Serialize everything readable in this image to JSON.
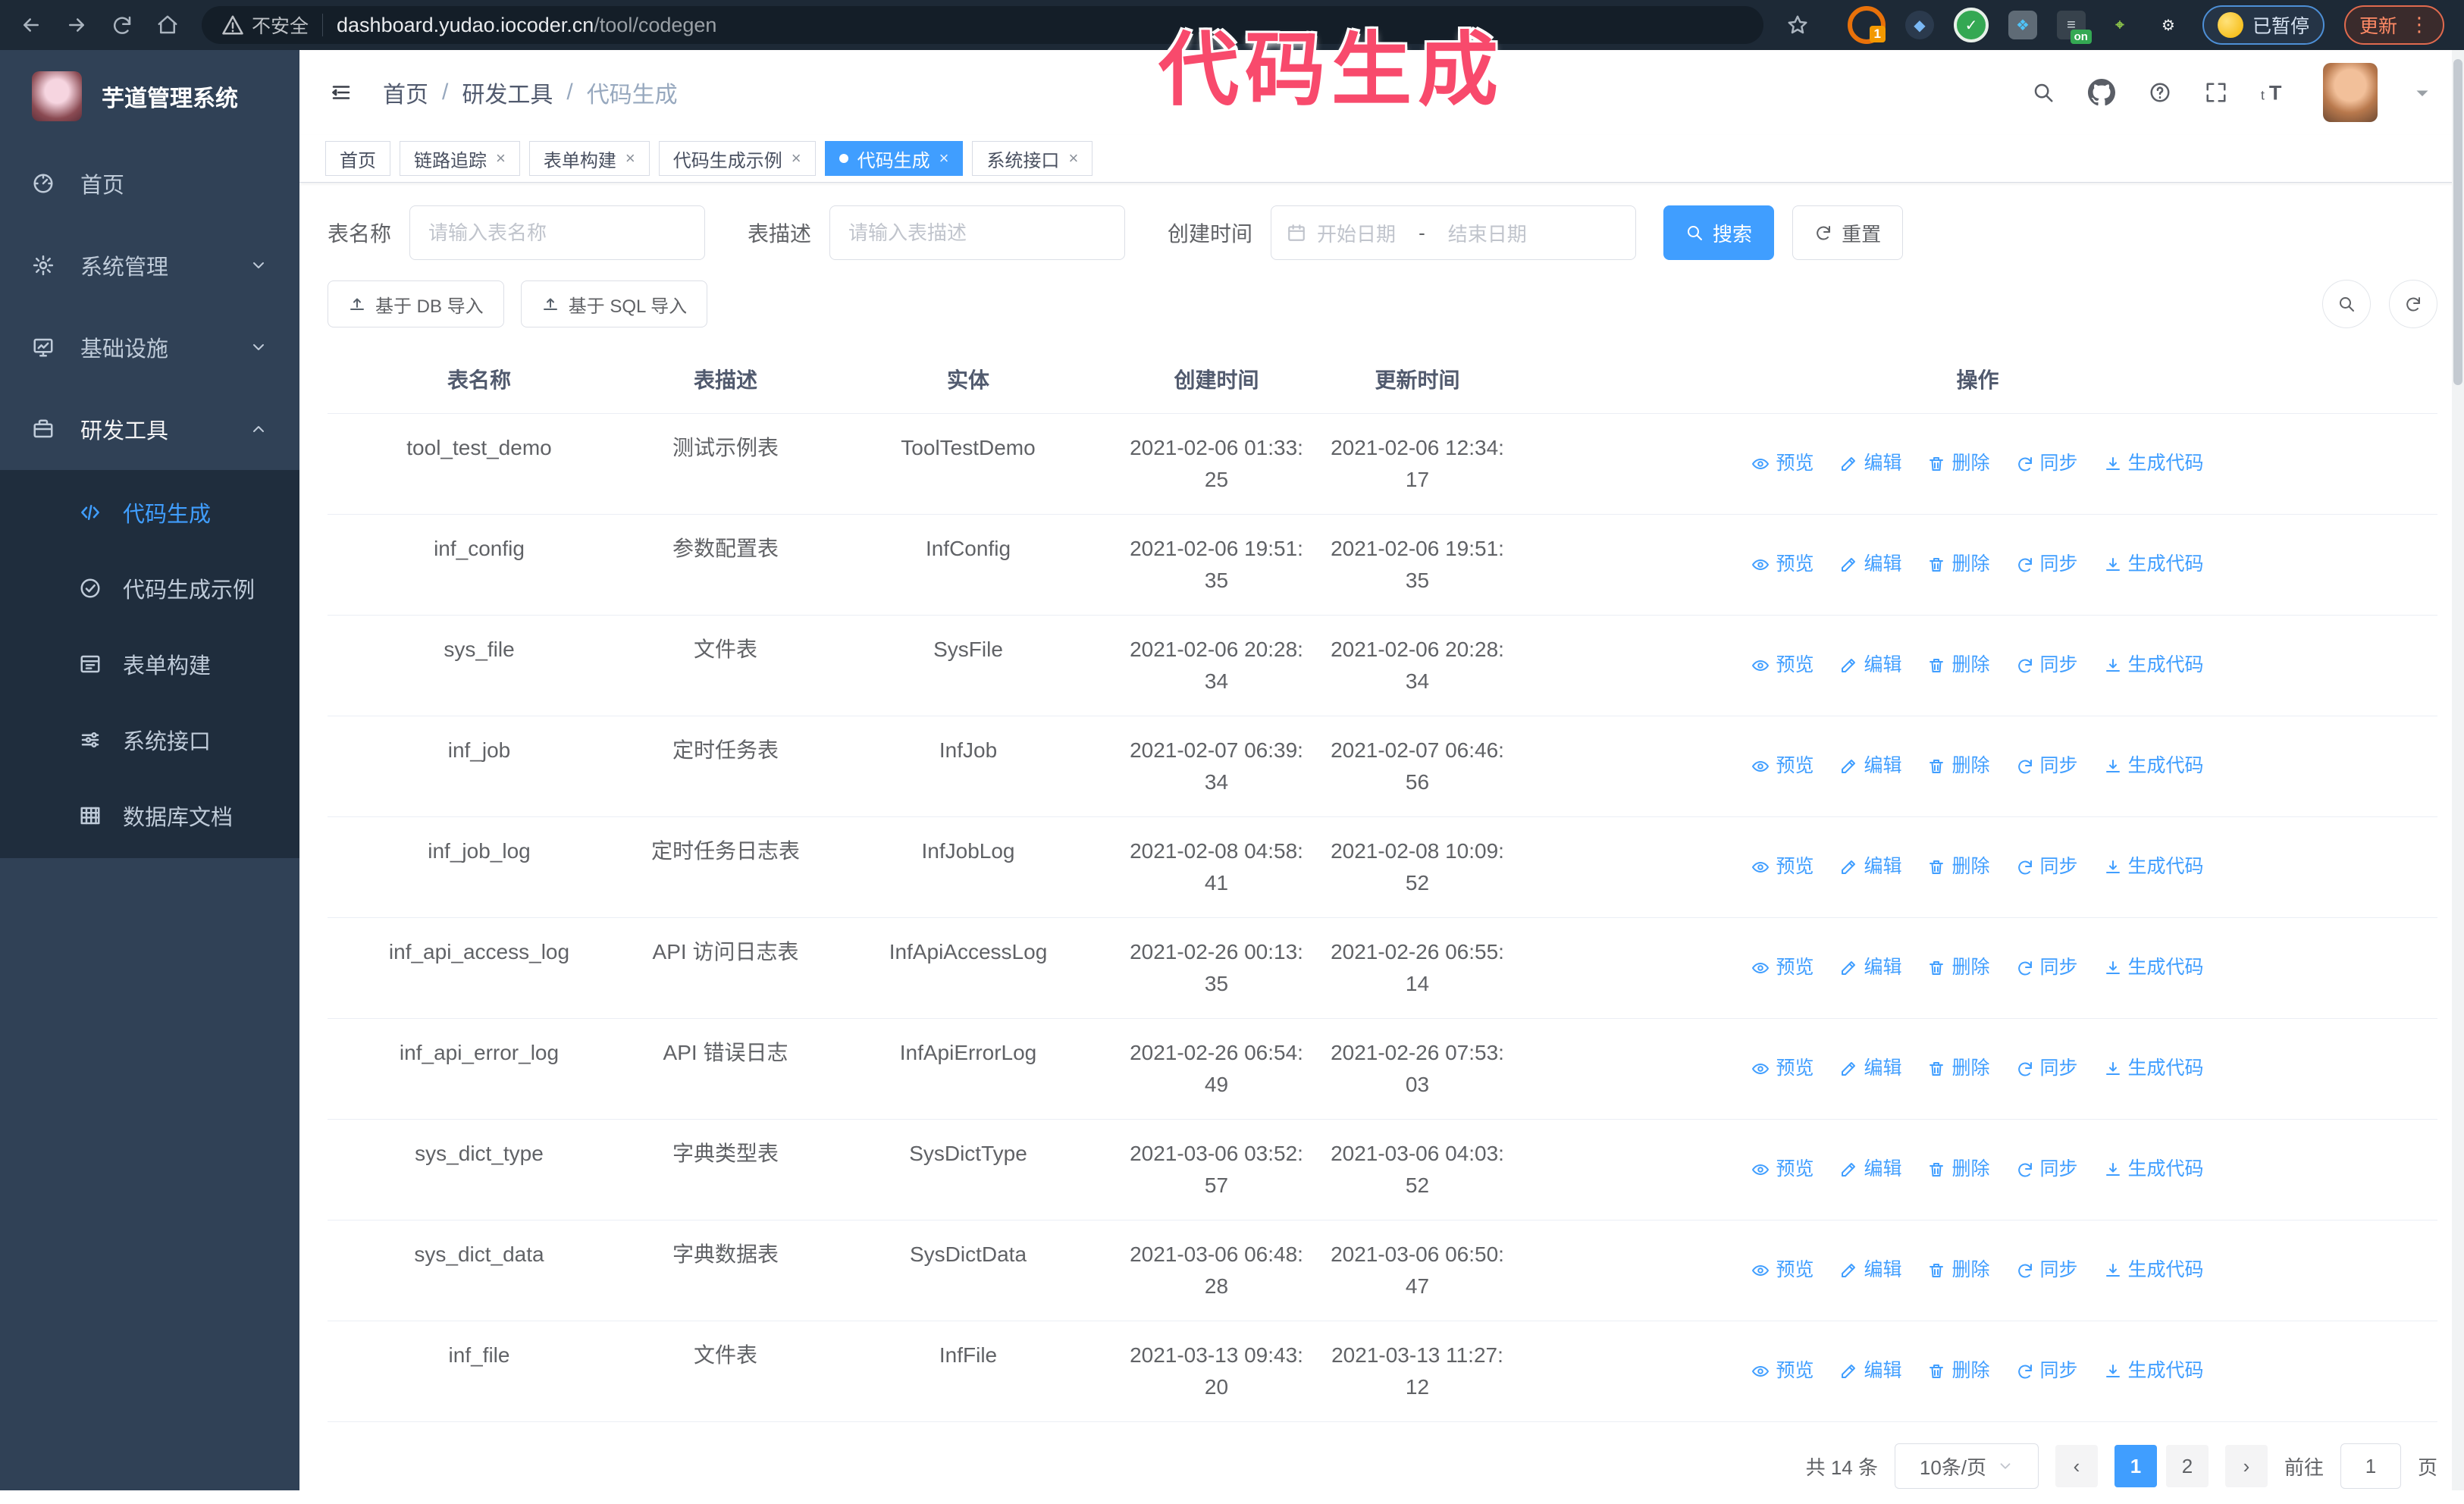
{
  "browser": {
    "security_label": "不安全",
    "url_host": "dashboard.yudao.iocoder.cn",
    "url_path": "/tool/codegen",
    "extension_badge": "1",
    "extension_on_badge": "on",
    "paused_label": "已暂停",
    "update_label": "更新"
  },
  "annotation": {
    "text": "代码生成",
    "color": "#f84a6c"
  },
  "sidebar": {
    "title": "芋道管理系统",
    "items": [
      {
        "label": "首页",
        "icon": "dashboard",
        "expandable": false,
        "expanded": false,
        "lit": false
      },
      {
        "label": "系统管理",
        "icon": "gear",
        "expandable": true,
        "expanded": false,
        "lit": false
      },
      {
        "label": "基础设施",
        "icon": "monitor",
        "expandable": true,
        "expanded": false,
        "lit": false
      },
      {
        "label": "研发工具",
        "icon": "briefcase",
        "expandable": true,
        "expanded": true,
        "lit": true
      }
    ],
    "submenu": [
      {
        "label": "代码生成",
        "icon": "code",
        "active": true
      },
      {
        "label": "代码生成示例",
        "icon": "check-circle",
        "active": false
      },
      {
        "label": "表单构建",
        "icon": "form",
        "active": false
      },
      {
        "label": "系统接口",
        "icon": "sliders",
        "active": false
      },
      {
        "label": "数据库文档",
        "icon": "grid",
        "active": false
      }
    ]
  },
  "header": {
    "breadcrumb": [
      "首页",
      "研发工具",
      "代码生成"
    ]
  },
  "tags": [
    {
      "label": "首页",
      "closable": false,
      "active": false
    },
    {
      "label": "链路追踪",
      "closable": true,
      "active": false
    },
    {
      "label": "表单构建",
      "closable": true,
      "active": false
    },
    {
      "label": "代码生成示例",
      "closable": true,
      "active": false
    },
    {
      "label": "代码生成",
      "closable": true,
      "active": true
    },
    {
      "label": "系统接口",
      "closable": true,
      "active": false
    }
  ],
  "filters": {
    "table_name_label": "表名称",
    "table_name_placeholder": "请输入表名称",
    "table_desc_label": "表描述",
    "table_desc_placeholder": "请输入表描述",
    "create_time_label": "创建时间",
    "date_start_placeholder": "开始日期",
    "date_separator": "-",
    "date_end_placeholder": "结束日期",
    "search_label": "搜索",
    "reset_label": "重置"
  },
  "toolbar": {
    "import_db_label": "基于 DB 导入",
    "import_sql_label": "基于 SQL 导入"
  },
  "table": {
    "columns": [
      "表名称",
      "表描述",
      "实体",
      "创建时间",
      "更新时间",
      "操作"
    ],
    "actions": [
      {
        "label": "预览",
        "icon": "eye"
      },
      {
        "label": "编辑",
        "icon": "edit"
      },
      {
        "label": "删除",
        "icon": "trash"
      },
      {
        "label": "同步",
        "icon": "sync"
      },
      {
        "label": "生成代码",
        "icon": "download"
      }
    ],
    "rows": [
      {
        "name": "tool_test_demo",
        "desc": "测试示例表",
        "entity": "ToolTestDemo",
        "created": "2021-02-06 01:33:25",
        "updated": "2021-02-06 12:34:17"
      },
      {
        "name": "inf_config",
        "desc": "参数配置表",
        "entity": "InfConfig",
        "created": "2021-02-06 19:51:35",
        "updated": "2021-02-06 19:51:35"
      },
      {
        "name": "sys_file",
        "desc": "文件表",
        "entity": "SysFile",
        "created": "2021-02-06 20:28:34",
        "updated": "2021-02-06 20:28:34"
      },
      {
        "name": "inf_job",
        "desc": "定时任务表",
        "entity": "InfJob",
        "created": "2021-02-07 06:39:34",
        "updated": "2021-02-07 06:46:56"
      },
      {
        "name": "inf_job_log",
        "desc": "定时任务日志表",
        "entity": "InfJobLog",
        "created": "2021-02-08 04:58:41",
        "updated": "2021-02-08 10:09:52"
      },
      {
        "name": "inf_api_access_log",
        "desc": "API 访问日志表",
        "entity": "InfApiAccessLog",
        "created": "2021-02-26 00:13:35",
        "updated": "2021-02-26 06:55:14"
      },
      {
        "name": "inf_api_error_log",
        "desc": "API 错误日志",
        "entity": "InfApiErrorLog",
        "created": "2021-02-26 06:54:49",
        "updated": "2021-02-26 07:53:03"
      },
      {
        "name": "sys_dict_type",
        "desc": "字典类型表",
        "entity": "SysDictType",
        "created": "2021-03-06 03:52:57",
        "updated": "2021-03-06 04:03:52"
      },
      {
        "name": "sys_dict_data",
        "desc": "字典数据表",
        "entity": "SysDictData",
        "created": "2021-03-06 06:48:28",
        "updated": "2021-03-06 06:50:47"
      },
      {
        "name": "inf_file",
        "desc": "文件表",
        "entity": "InfFile",
        "created": "2021-03-13 09:43:20",
        "updated": "2021-03-13 11:27:12"
      }
    ]
  },
  "pagination": {
    "total_label": "共 14 条",
    "page_size_label": "10条/页",
    "pages": [
      "1",
      "2"
    ],
    "active_page": "1",
    "goto_label": "前往",
    "goto_value": "1",
    "page_suffix": "页"
  },
  "colors": {
    "primary": "#409eff",
    "sidebar_bg": "#304156",
    "submenu_bg": "#1f2d3d",
    "browser_bar_bg": "#1d2936",
    "annotation": "#f84a6c"
  }
}
